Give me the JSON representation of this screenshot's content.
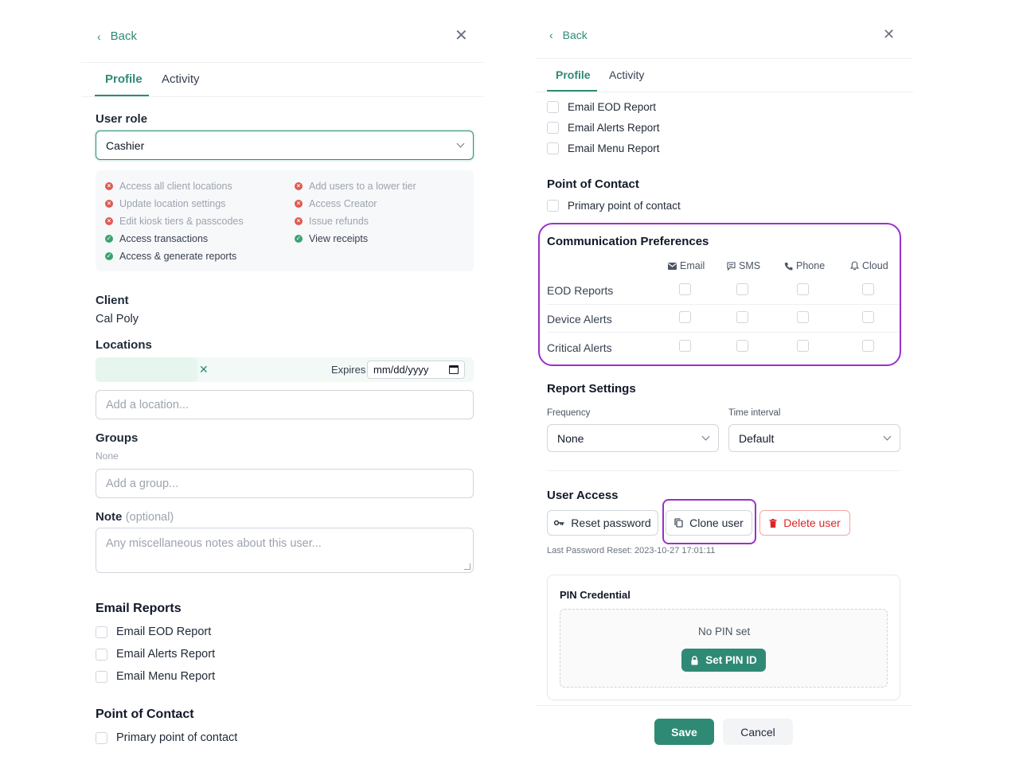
{
  "left": {
    "back_label": "Back",
    "tabs": [
      {
        "label": "Profile"
      },
      {
        "label": "Activity"
      }
    ],
    "user_role": {
      "label": "User role",
      "value": "Cashier"
    },
    "permissions": [
      {
        "label": "Access all client locations",
        "allowed": false
      },
      {
        "label": "Add users to a lower tier",
        "allowed": false
      },
      {
        "label": "Update location settings",
        "allowed": false
      },
      {
        "label": "Access Creator",
        "allowed": false
      },
      {
        "label": "Edit kiosk tiers & passcodes",
        "allowed": false
      },
      {
        "label": "Issue refunds",
        "allowed": false
      },
      {
        "label": "Access transactions",
        "allowed": true
      },
      {
        "label": "View receipts",
        "allowed": true
      },
      {
        "label": "Access & generate reports",
        "allowed": true
      }
    ],
    "client": {
      "label": "Client",
      "value": "Cal Poly"
    },
    "locations": {
      "label": "Locations",
      "expires_label": "Expires",
      "date_placeholder": "mm/dd/yyyy",
      "add_placeholder": "Add a location..."
    },
    "groups": {
      "label": "Groups",
      "value": "None",
      "add_placeholder": "Add a group..."
    },
    "note": {
      "label": "Note",
      "optional": "(optional)",
      "placeholder": "Any miscellaneous notes about this user..."
    },
    "email_reports": {
      "title": "Email Reports",
      "items": [
        {
          "label": "Email EOD Report"
        },
        {
          "label": "Email Alerts Report"
        },
        {
          "label": "Email Menu Report"
        }
      ]
    },
    "point_of_contact": {
      "title": "Point of Contact",
      "item": "Primary point of contact"
    }
  },
  "right": {
    "back_label": "Back",
    "tabs": [
      {
        "label": "Profile"
      },
      {
        "label": "Activity"
      }
    ],
    "email_items": [
      {
        "label": "Email EOD Report"
      },
      {
        "label": "Email Alerts Report"
      },
      {
        "label": "Email Menu Report"
      }
    ],
    "point_of_contact": {
      "title": "Point of Contact",
      "item": "Primary point of contact"
    },
    "comm_prefs": {
      "title": "Communication Preferences",
      "columns": [
        {
          "label": "Email",
          "icon": "mail-icon"
        },
        {
          "label": "SMS",
          "icon": "message-icon"
        },
        {
          "label": "Phone",
          "icon": "phone-icon"
        },
        {
          "label": "Cloud",
          "icon": "bell-icon"
        }
      ],
      "rows": [
        {
          "label": "EOD Reports"
        },
        {
          "label": "Device Alerts"
        },
        {
          "label": "Critical Alerts"
        }
      ]
    },
    "report_settings": {
      "title": "Report Settings",
      "frequency_label": "Frequency",
      "frequency_value": "None",
      "interval_label": "Time interval",
      "interval_value": "Default"
    },
    "user_access": {
      "title": "User Access",
      "reset_label": "Reset password",
      "clone_label": "Clone user",
      "delete_label": "Delete user",
      "last_reset": "Last Password Reset: 2023-10-27 17:01:11"
    },
    "pin": {
      "title": "PIN Credential",
      "status": "No PIN set",
      "button": "Set PIN ID"
    },
    "footer": {
      "save": "Save",
      "cancel": "Cancel"
    }
  },
  "colors": {
    "accent": "#2f8a75",
    "highlight": "#9b30c9",
    "danger": "#dc2626",
    "deny": "#e05a52",
    "allow": "#3aa372"
  }
}
